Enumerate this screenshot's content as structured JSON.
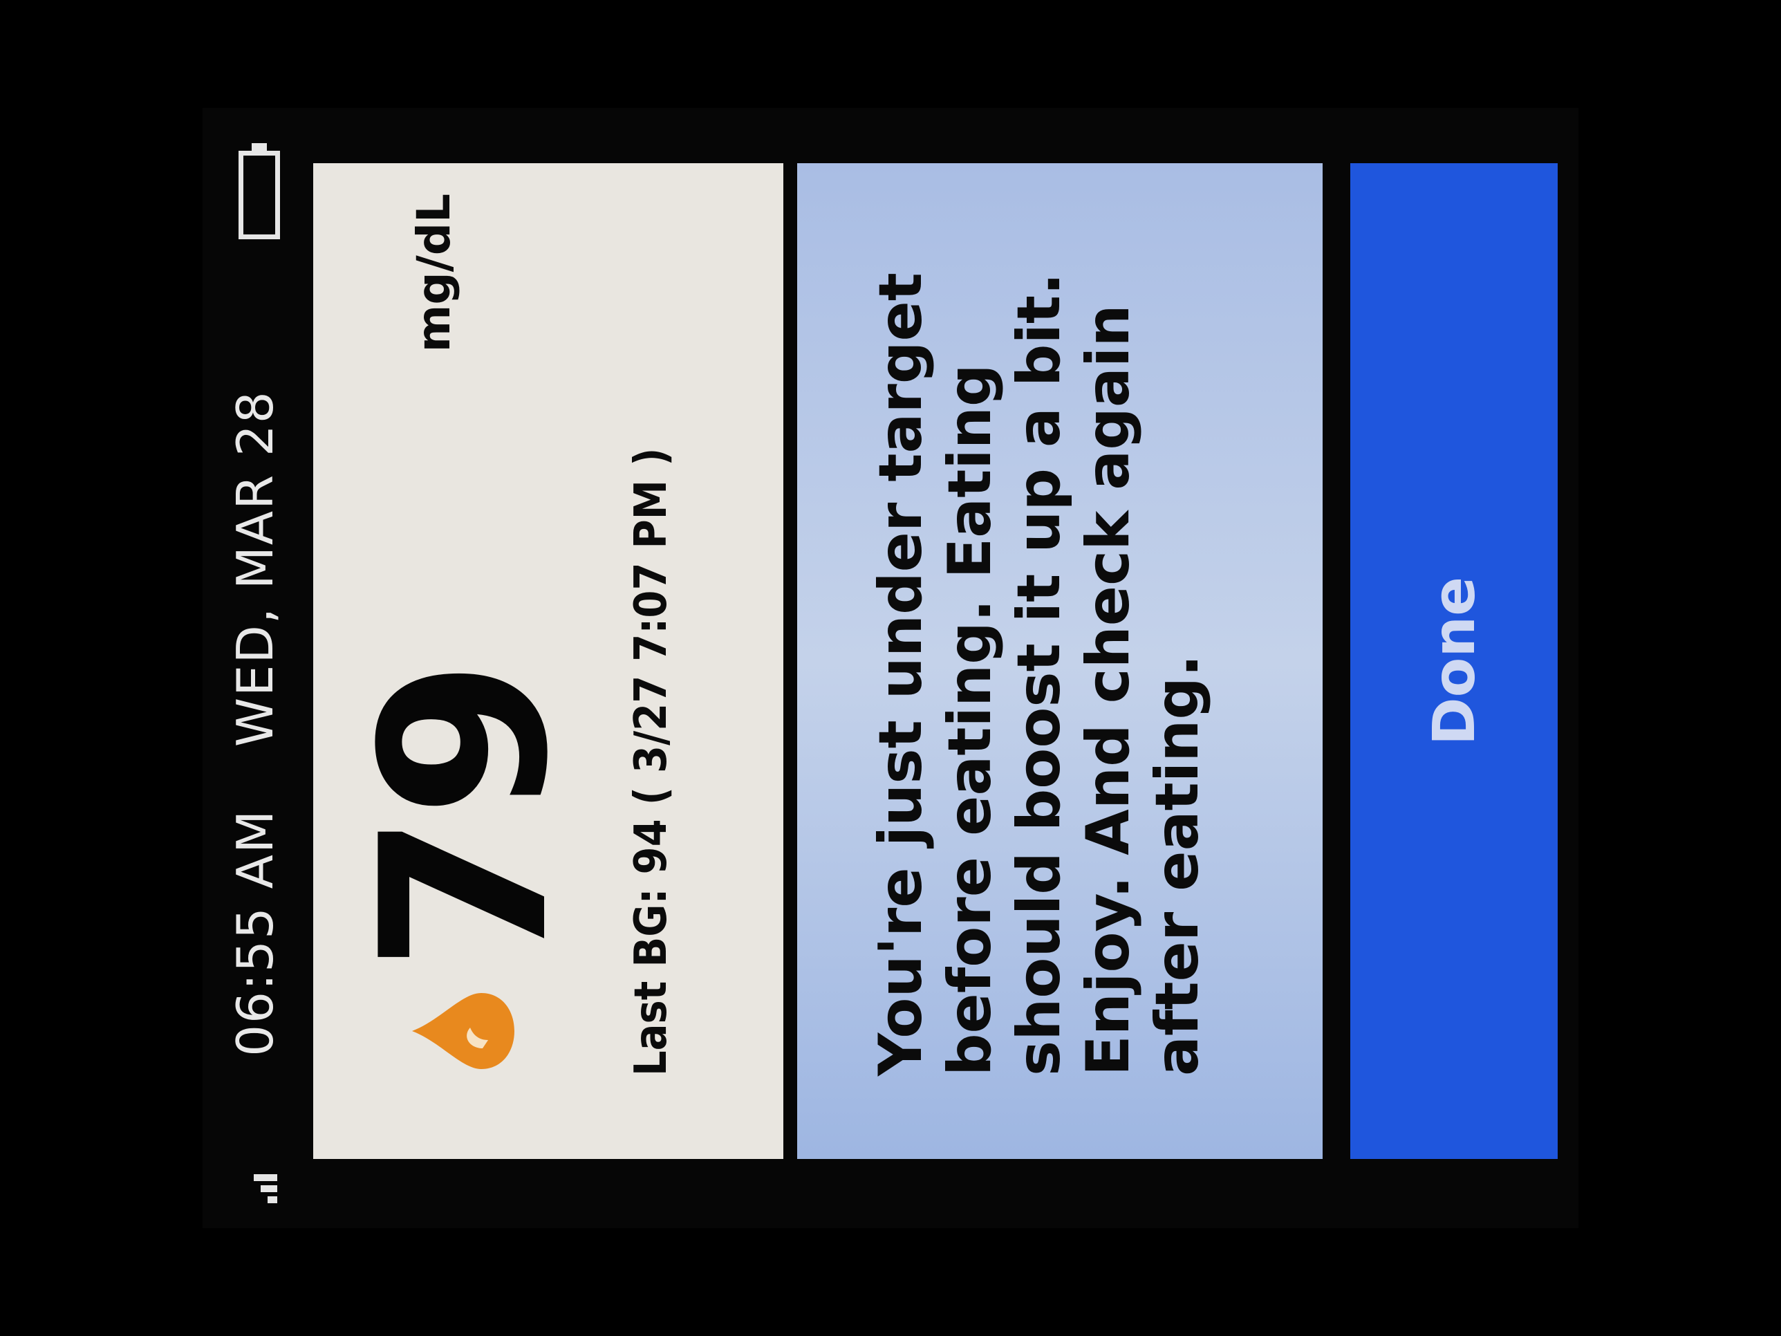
{
  "status_bar": {
    "time": "06:55 AM",
    "date": "WED, MAR 28",
    "signal_icon": "signal-strength-icon",
    "battery_icon": "battery-icon"
  },
  "reading": {
    "value": "79",
    "unit": "mg/dL",
    "icon": "blood-drop-icon",
    "last_bg_text": "Last BG: 94 ( 3/27  7:07 PM )"
  },
  "message": {
    "text": "You're just under target before eating. Eating should boost it up a bit. Enjoy. And check again after eating."
  },
  "actions": {
    "done_label": "Done"
  },
  "colors": {
    "screen_bg": "#060606",
    "reading_panel_bg": "#e9e6e0",
    "message_panel_bg": "#b7c9e8",
    "done_button_bg": "#1f56dd",
    "drop_accent": "#e8891e"
  }
}
